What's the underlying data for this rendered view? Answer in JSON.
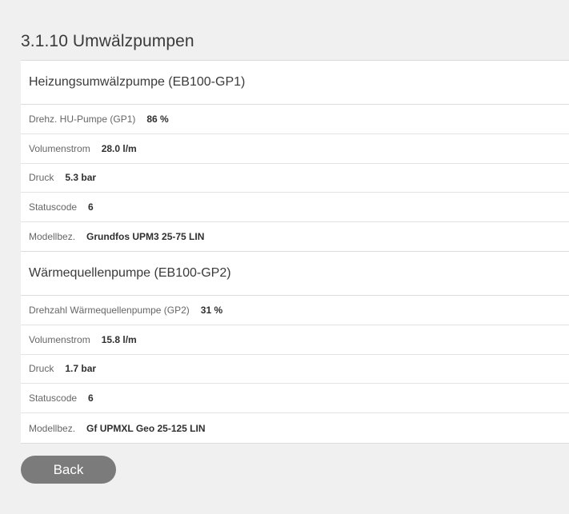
{
  "page": {
    "title": "3.1.10 Umwälzpumpen"
  },
  "sections": [
    {
      "title": "Heizungsumwälzpumpe (EB100-GP1)",
      "rows": [
        {
          "label": "Drehz. HU-Pumpe (GP1)",
          "value": "86 %"
        },
        {
          "label": "Volumenstrom",
          "value": "28.0 l/m"
        },
        {
          "label": "Druck",
          "value": "5.3 bar"
        },
        {
          "label": "Statuscode",
          "value": "6"
        },
        {
          "label": "Modellbez.",
          "value": "Grundfos UPM3 25-75 LIN"
        }
      ]
    },
    {
      "title": "Wärmequellenpumpe (EB100-GP2)",
      "rows": [
        {
          "label": "Drehzahl Wärmequellenpumpe (GP2)",
          "value": "31 %"
        },
        {
          "label": "Volumenstrom",
          "value": "15.8 l/m"
        },
        {
          "label": "Druck",
          "value": "1.7 bar"
        },
        {
          "label": "Statuscode",
          "value": "6"
        },
        {
          "label": "Modellbez.",
          "value": "Gf UPMXL Geo 25-125 LIN"
        }
      ]
    }
  ],
  "actions": {
    "back_label": "Back"
  }
}
